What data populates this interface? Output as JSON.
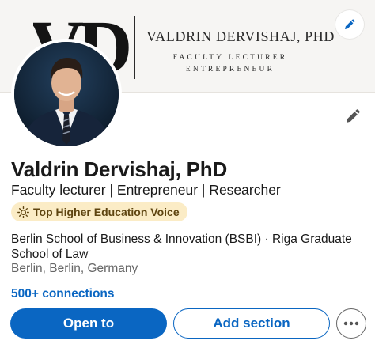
{
  "banner": {
    "monogram": "VD",
    "name": "VALDRIN DERVISHAJ, PHD",
    "subtitle_line1": "FACULTY LECTURER",
    "subtitle_line2": "ENTREPRENEUR",
    "edit_icon": "pencil-icon"
  },
  "profile": {
    "name": "Valdrin Dervishaj, PhD",
    "headline": "Faculty lecturer | Entrepreneur | Researcher",
    "badge": {
      "icon": "sun-icon",
      "label": "Top Higher Education Voice"
    },
    "education": "Berlin School of Business & Innovation (BSBI) · Riga Graduate School of Law",
    "location": "Berlin, Berlin, Germany",
    "connections": "500+ connections",
    "edit_icon": "pencil-icon"
  },
  "actions": {
    "open_to": "Open to",
    "add_section": "Add section",
    "more_icon": "ellipsis-icon"
  },
  "colors": {
    "accent": "#0a66c2",
    "badge_bg": "#fbecc6",
    "badge_text": "#5e4410",
    "secondary_text": "#666666",
    "banner_bg": "#f6f5f3"
  }
}
